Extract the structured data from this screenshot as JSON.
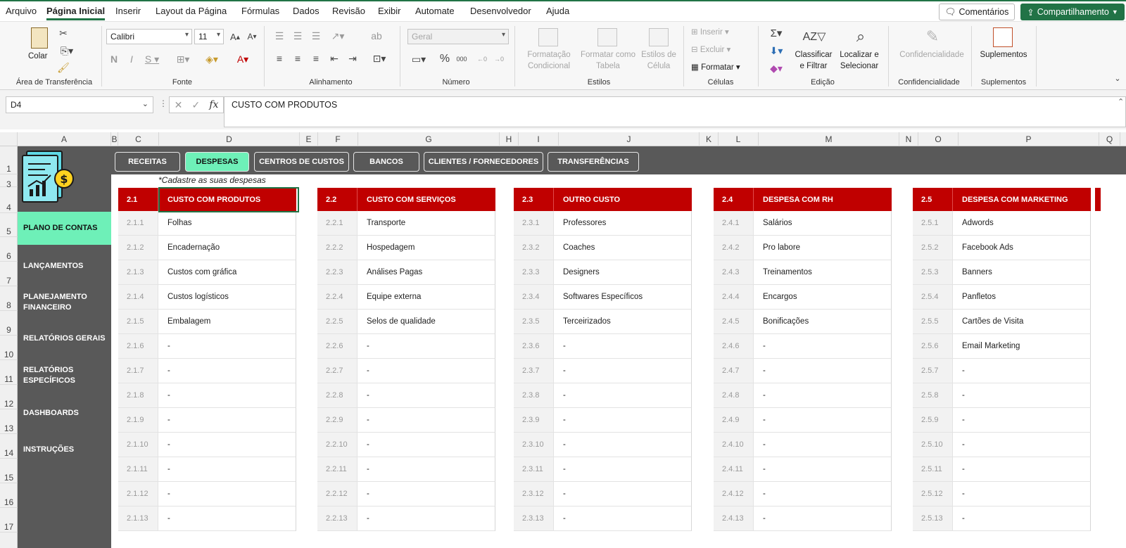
{
  "menu": {
    "tabs": [
      "Arquivo",
      "Página Inicial",
      "Inserir",
      "Layout da Página",
      "Fórmulas",
      "Dados",
      "Revisão",
      "Exibir",
      "Automate",
      "Desenvolvedor",
      "Ajuda"
    ],
    "active_tab": "Página Inicial",
    "comments_label": "Comentários",
    "share_label": "Compartilhamento"
  },
  "ribbon": {
    "clipboard": {
      "paste_label": "Colar",
      "group": "Área de Transferência"
    },
    "font": {
      "name": "Calibri",
      "size": "11",
      "group": "Fonte"
    },
    "alignment": {
      "group": "Alinhamento"
    },
    "number": {
      "format": "Geral",
      "group": "Número"
    },
    "styles": {
      "conditional": "Formatação Condicional",
      "table": "Formatar como Tabela",
      "cell": "Estilos de Célula",
      "group": "Estilos"
    },
    "cells": {
      "insert": "Inserir",
      "delete": "Excluir",
      "format": "Formatar",
      "group": "Células"
    },
    "editing": {
      "sort": "Classificar e Filtrar",
      "find": "Localizar e Selecionar",
      "group": "Edição"
    },
    "sensitivity": {
      "label": "Confidencialidade",
      "group": "Confidencialidade"
    },
    "addins": {
      "label": "Suplementos",
      "group": "Suplementos"
    }
  },
  "formula_bar": {
    "name_box": "D4",
    "formula": "CUSTO COM PRODUTOS"
  },
  "columns": [
    "A",
    "B",
    "C",
    "D",
    "E",
    "F",
    "G",
    "H",
    "I",
    "J",
    "K",
    "L",
    "M",
    "N",
    "O",
    "P",
    "Q"
  ],
  "rows": [
    "1",
    "3",
    "4",
    "5",
    "6",
    "7",
    "8",
    "9",
    "10",
    "11",
    "12",
    "13",
    "14",
    "15",
    "16",
    "17"
  ],
  "sidebar": {
    "items": [
      "PLANO DE CONTAS",
      "LANÇAMENTOS",
      "PLANEJAMENTO FINANCEIRO",
      "RELATÓRIOS GERAIS",
      "RELATÓRIOS ESPECÍFICOS",
      "DASHBOARDS",
      "INSTRUÇÕES"
    ],
    "active": "PLANO DE CONTAS"
  },
  "top_tabs": {
    "items": [
      "RECEITAS",
      "DESPESAS",
      "CENTROS DE CUSTOS",
      "BANCOS",
      "CLIENTES / FORNECEDORES",
      "TRANSFERÊNCIAS"
    ],
    "active": "DESPESAS"
  },
  "note": "*Cadastre as suas despesas",
  "categories": [
    {
      "code": "2.1",
      "name": "CUSTO COM PRODUTOS",
      "rows": [
        [
          "2.1.1",
          "Folhas"
        ],
        [
          "2.1.2",
          "Encadernação"
        ],
        [
          "2.1.3",
          "Custos com gráfica"
        ],
        [
          "2.1.4",
          "Custos logísticos"
        ],
        [
          "2.1.5",
          "Embalagem"
        ],
        [
          "2.1.6",
          "-"
        ],
        [
          "2.1.7",
          "-"
        ],
        [
          "2.1.8",
          "-"
        ],
        [
          "2.1.9",
          "-"
        ],
        [
          "2.1.10",
          "-"
        ],
        [
          "2.1.11",
          "-"
        ],
        [
          "2.1.12",
          "-"
        ],
        [
          "2.1.13",
          "-"
        ]
      ]
    },
    {
      "code": "2.2",
      "name": "CUSTO COM SERVIÇOS",
      "rows": [
        [
          "2.2.1",
          "Transporte"
        ],
        [
          "2.2.2",
          "Hospedagem"
        ],
        [
          "2.2.3",
          "Análises Pagas"
        ],
        [
          "2.2.4",
          "Equipe externa"
        ],
        [
          "2.2.5",
          "Selos de qualidade"
        ],
        [
          "2.2.6",
          "-"
        ],
        [
          "2.2.7",
          "-"
        ],
        [
          "2.2.8",
          "-"
        ],
        [
          "2.2.9",
          "-"
        ],
        [
          "2.2.10",
          "-"
        ],
        [
          "2.2.11",
          "-"
        ],
        [
          "2.2.12",
          "-"
        ],
        [
          "2.2.13",
          "-"
        ]
      ]
    },
    {
      "code": "2.3",
      "name": "OUTRO CUSTO",
      "rows": [
        [
          "2.3.1",
          "Professores"
        ],
        [
          "2.3.2",
          "Coaches"
        ],
        [
          "2.3.3",
          "Designers"
        ],
        [
          "2.3.4",
          "Softwares Específicos"
        ],
        [
          "2.3.5",
          "Terceirizados"
        ],
        [
          "2.3.6",
          "-"
        ],
        [
          "2.3.7",
          "-"
        ],
        [
          "2.3.8",
          "-"
        ],
        [
          "2.3.9",
          "-"
        ],
        [
          "2.3.10",
          "-"
        ],
        [
          "2.3.11",
          "-"
        ],
        [
          "2.3.12",
          "-"
        ],
        [
          "2.3.13",
          "-"
        ]
      ]
    },
    {
      "code": "2.4",
      "name": "DESPESA COM RH",
      "rows": [
        [
          "2.4.1",
          "Salários"
        ],
        [
          "2.4.2",
          "Pro labore"
        ],
        [
          "2.4.3",
          "Treinamentos"
        ],
        [
          "2.4.4",
          "Encargos"
        ],
        [
          "2.4.5",
          "Bonificações"
        ],
        [
          "2.4.6",
          "-"
        ],
        [
          "2.4.7",
          "-"
        ],
        [
          "2.4.8",
          "-"
        ],
        [
          "2.4.9",
          "-"
        ],
        [
          "2.4.10",
          "-"
        ],
        [
          "2.4.11",
          "-"
        ],
        [
          "2.4.12",
          "-"
        ],
        [
          "2.4.13",
          "-"
        ]
      ]
    },
    {
      "code": "2.5",
      "name": "DESPESA COM MARKETING",
      "rows": [
        [
          "2.5.1",
          "Adwords"
        ],
        [
          "2.5.2",
          "Facebook Ads"
        ],
        [
          "2.5.3",
          "Banners"
        ],
        [
          "2.5.4",
          "Panfletos"
        ],
        [
          "2.5.5",
          "Cartões de Visita"
        ],
        [
          "2.5.6",
          "Email Marketing"
        ],
        [
          "2.5.7",
          "-"
        ],
        [
          "2.5.8",
          "-"
        ],
        [
          "2.5.9",
          "-"
        ],
        [
          "2.5.10",
          "-"
        ],
        [
          "2.5.11",
          "-"
        ],
        [
          "2.5.12",
          "-"
        ],
        [
          "2.5.13",
          "-"
        ]
      ]
    }
  ],
  "colors": {
    "excel_green": "#217346",
    "header_red": "#c00000",
    "sidebar_gray": "#595959",
    "active_mint": "#6ef0b8"
  }
}
